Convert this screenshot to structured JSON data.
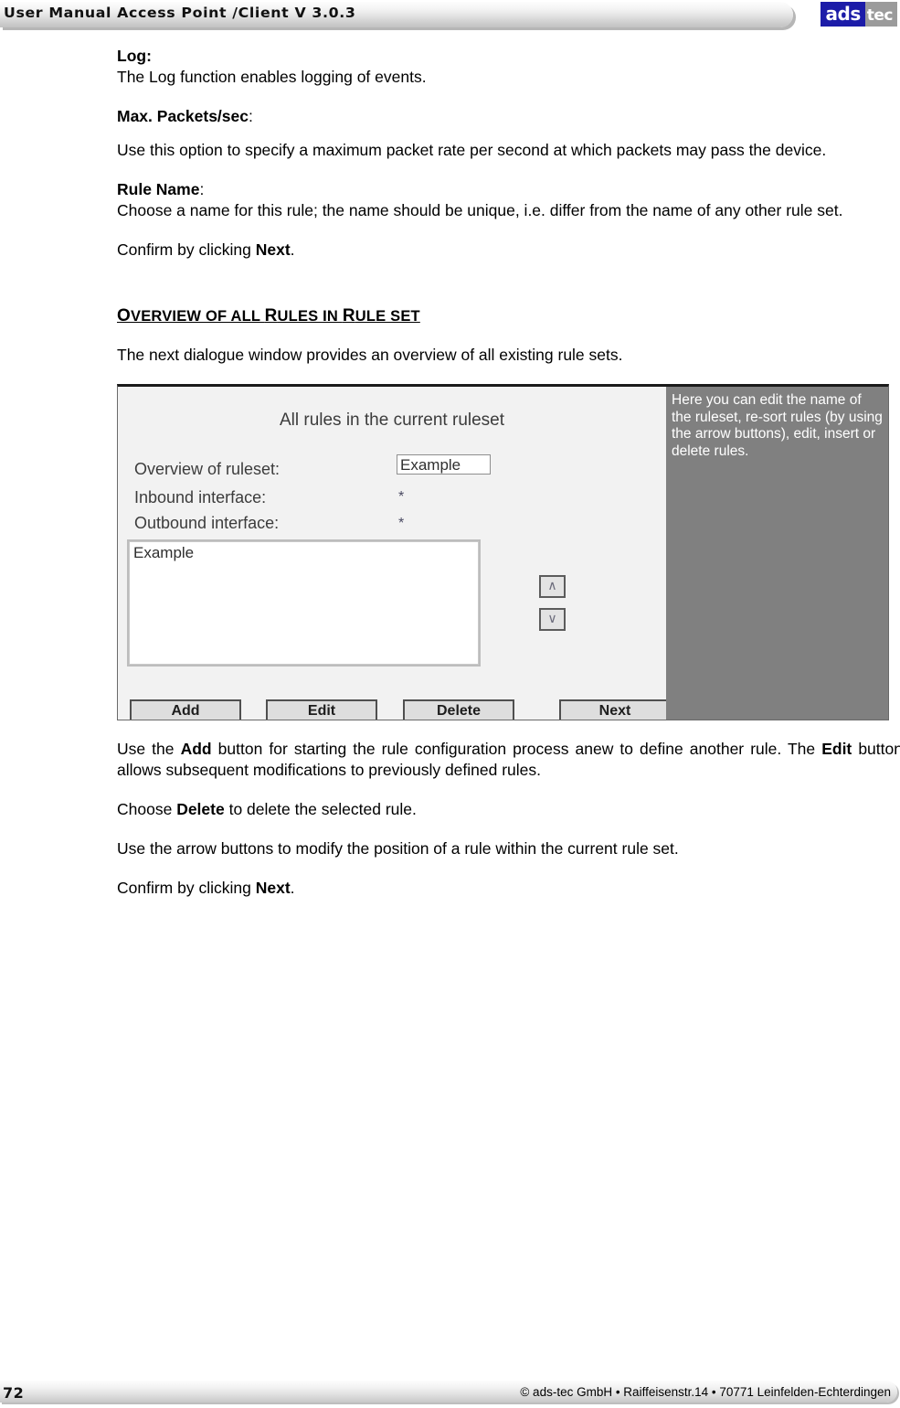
{
  "header": {
    "title": "User Manual Access Point /Client V 3.0.3",
    "logo_ads": "ads",
    "logo_tec": "tec"
  },
  "content": {
    "log_term": "Log:",
    "log_desc": "The Log function enables logging of events.",
    "max_packets_term": "Max. Packets/sec",
    "max_packets_colon": ":",
    "max_packets_desc": "Use this option to specify a maximum packet rate per second at which packets may pass the device.",
    "rule_name_term": "Rule Name",
    "rule_name_colon": ":",
    "rule_name_desc": "Choose a name for this rule; the name should be unique, i.e. differ from the name of any other rule set.",
    "confirm_pre": "Confirm by clicking ",
    "confirm_next": "Next",
    "confirm_post": ".",
    "section_heading_o": "O",
    "section_heading_verview_of_all": "VERVIEW OF ALL ",
    "section_heading_r1": "R",
    "section_heading_ules_in": "ULES IN ",
    "section_heading_r2": "R",
    "section_heading_ule_set": "ULE SET",
    "intro_next_dialogue": "The next dialogue window provides an overview of all existing rule sets.",
    "after_add_1": "Use the ",
    "after_add_bold": "Add",
    "after_add_2": " button for starting the rule configuration process anew to define another rule. The ",
    "after_edit_bold": "Edit",
    "after_edit_2": " button allows subsequent modifications to previously defined rules.",
    "choose_pre": "Choose ",
    "choose_delete": "Delete",
    "choose_post": " to delete the selected rule.",
    "arrow_desc": "Use the arrow buttons to modify the position of a rule within the current rule set."
  },
  "dialog": {
    "title": "All rules in the current ruleset",
    "label_overview": "Overview of ruleset:",
    "label_inbound": "Inbound interface:",
    "label_outbound": "Outbound interface:",
    "ruleset_value": "Example",
    "inbound_value": "*",
    "outbound_value": "*",
    "list_items": [
      "Example"
    ],
    "arrow_up": "∧",
    "arrow_down": "∨",
    "buttons": {
      "add": "Add",
      "edit": "Edit",
      "delete": "Delete",
      "next": "Next"
    },
    "help_text": "Here you can edit the name of the ruleset, re-sort rules (by using the arrow buttons), edit, insert or delete rules."
  },
  "footer": {
    "page_number": "72",
    "copyright": "© ads-tec GmbH • Raiffeisenstr.14 • 70771 Leinfelden-Echterdingen"
  }
}
